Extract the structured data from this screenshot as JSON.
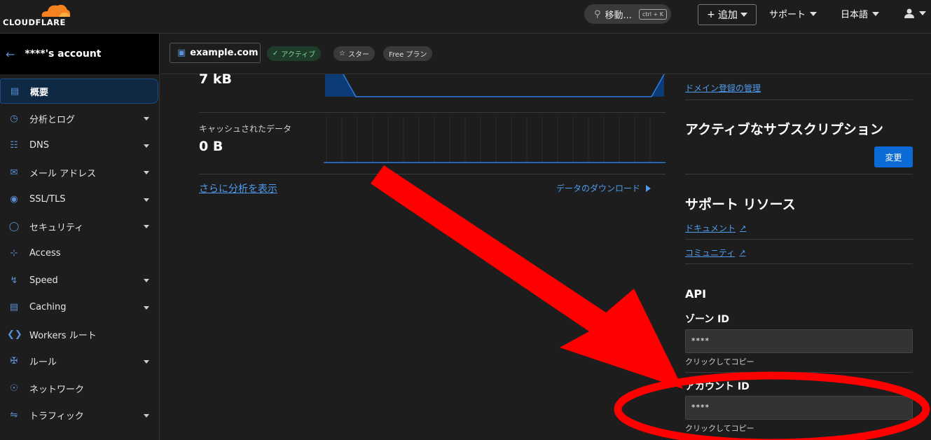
{
  "topbar": {
    "logo_text": "CLOUDFLARE",
    "search_label": "移動...",
    "search_shortcut": "ctrl + K",
    "add_label": "追加",
    "support_label": "サポート",
    "language_label": "日本語"
  },
  "account": {
    "name": "****'s account"
  },
  "sidebar": {
    "items": [
      {
        "label": "概要",
        "icon": "document-icon"
      },
      {
        "label": "分析とログ",
        "icon": "chart-icon"
      },
      {
        "label": "DNS",
        "icon": "network-icon"
      },
      {
        "label": "メール アドレス",
        "icon": "envelope-icon"
      },
      {
        "label": "SSL/TLS",
        "icon": "lock-icon"
      },
      {
        "label": "セキュリティ",
        "icon": "shield-icon"
      },
      {
        "label": "Access",
        "icon": "access-icon"
      },
      {
        "label": "Speed",
        "icon": "lightning-icon"
      },
      {
        "label": "Caching",
        "icon": "server-icon"
      },
      {
        "label": "Workers ルート",
        "icon": "workers-icon"
      },
      {
        "label": "ルール",
        "icon": "fork-icon"
      },
      {
        "label": "ネットワーク",
        "icon": "location-icon"
      },
      {
        "label": "トラフィック",
        "icon": "traffic-icon"
      }
    ]
  },
  "zone": {
    "name": "example.com",
    "status": "アクティブ",
    "star": "スター",
    "plan": "Free プラン"
  },
  "analytics": {
    "metric1_value": "7 kB",
    "metric2_label": "キャッシュされたデータ",
    "metric2_value": "0 B",
    "more_link": "さらに分析を表示",
    "download_link": "データのダウンロード"
  },
  "right_panel": {
    "domain_link": "ドメイン登録の管理",
    "subscriptions_title": "アクティブなサブスクリプション",
    "change_button": "変更",
    "support_title": "サポート リソース",
    "docs_link": "ドキュメント",
    "community_link": "コミュニティ",
    "api_title": "API",
    "zone_id_label": "ゾーン ID",
    "zone_id_value": "****",
    "zone_id_hint": "クリックしてコピー",
    "account_id_label": "アカウント ID",
    "account_id_value": "****",
    "account_id_hint": "クリックしてコピー"
  },
  "colors": {
    "accent": "#0a6bd6",
    "link": "#4f9cf0",
    "annotation": "#ff0000",
    "brand_orange": "#f6821f"
  }
}
